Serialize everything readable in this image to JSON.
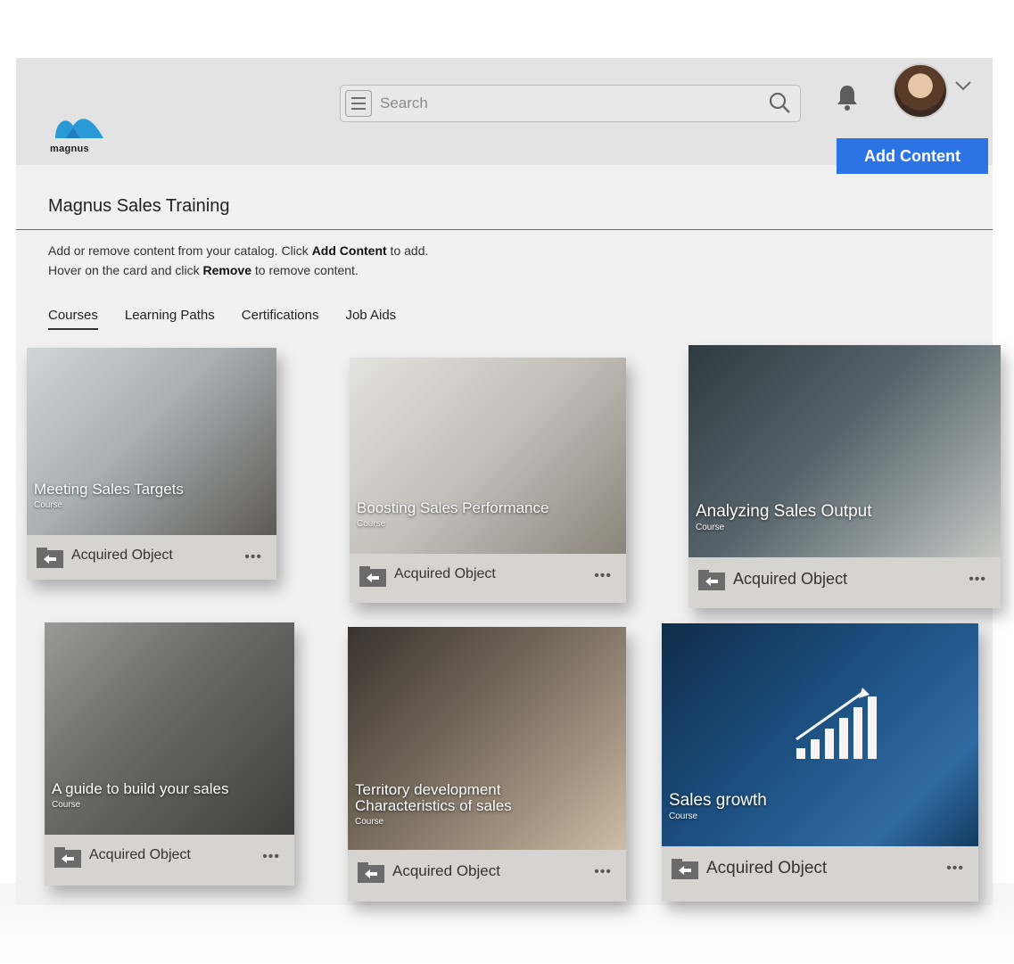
{
  "app": {
    "brand": "magnus",
    "page_title": "Magnus Sales Training",
    "search": {
      "placeholder": "Search"
    },
    "add_content_label": "Add Content",
    "instructions": {
      "line1_pre": "Add or remove content from your catalog. Click ",
      "line1_bold": "Add Content",
      "line1_post": " to add.",
      "line2_pre": "Hover on the card and click ",
      "line2_bold": "Remove",
      "line2_post": " to remove content."
    },
    "tabs": [
      {
        "label": "Courses",
        "active": true
      },
      {
        "label": "Learning Paths",
        "active": false
      },
      {
        "label": "Certifications",
        "active": false
      },
      {
        "label": "Job Aids",
        "active": false
      }
    ],
    "colors": {
      "accent": "#2c73e6",
      "logo": "#2a9ad6"
    }
  },
  "cards": [
    {
      "title": "Meeting Sales Targets",
      "kind": "Course",
      "status": "Acquired Object",
      "more": "•••",
      "theme": "#8a8f93"
    },
    {
      "title": "Boosting Sales Performance",
      "kind": "Course",
      "status": "Acquired Object",
      "more": "•••",
      "theme": "#a6a39d"
    },
    {
      "title": "Analyzing Sales Output",
      "kind": "Course",
      "status": "Acquired Object",
      "more": "•••",
      "theme": "#3d4a52"
    },
    {
      "title": "A guide to build your sales",
      "kind": "Course",
      "status": "Acquired Object",
      "more": "•••",
      "theme": "#6a6b6d"
    },
    {
      "title_line1": "Territory development",
      "title_line2": "Characteristics of sales",
      "kind": "Course",
      "status": "Acquired Object",
      "more": "•••",
      "theme": "#5e5448"
    },
    {
      "title": "Sales growth",
      "kind": "Course",
      "status": "Acquired Object",
      "more": "•••",
      "theme": "#123a5c"
    }
  ]
}
